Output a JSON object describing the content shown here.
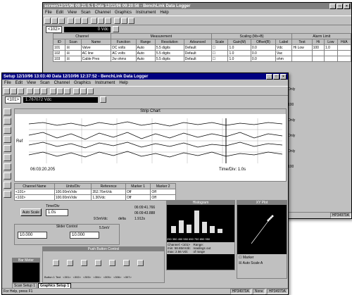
{
  "back_window": {
    "title": "screen12/11/96 09:21:5.1   Data 12/11/96 09:20:56 - BenchLink Data Logger",
    "menu": [
      "File",
      "Edit",
      "View",
      "Scan",
      "Channel",
      "Graphics",
      "Instrument",
      "Help"
    ],
    "channel_select": "<102>",
    "readout": "0 Vdc",
    "group_headers": {
      "channel": "Channel",
      "measurement": "Measurement",
      "scaling": "Scaling (Mx+B)",
      "alarm": "Alarm Limit"
    },
    "columns": [
      "ID",
      "Scan",
      "Name",
      "Function",
      "Range",
      "Resolution",
      "Advanced",
      "Scale",
      "Gain(M)",
      "Offset(B)",
      "Label",
      "Test",
      "Hi",
      "Low",
      "Hi/A"
    ],
    "rows": [
      {
        "id": "101",
        "name": "Valve",
        "function": "DC volts",
        "range": "Auto",
        "resolution": "5.5 digits",
        "advanced": "Default",
        "gain": "1.0",
        "offset": "0.0",
        "label": "Vdc",
        "test": "Hi Low",
        "hi": "100",
        "low": "1.0"
      },
      {
        "id": "102",
        "name": "AC line",
        "function": "AC volts",
        "range": "Auto",
        "resolution": "5.5 digits",
        "advanced": "Default",
        "gain": "1.0",
        "offset": "0.0",
        "label": "Vac",
        "test": "",
        "hi": "",
        "low": ""
      },
      {
        "id": "103",
        "name": "Cable Pres",
        "function": "2w ohms",
        "range": "Auto",
        "resolution": "5.5 digits",
        "advanced": "Default",
        "gain": "1.0",
        "offset": "0.0",
        "label": "ohm",
        "test": "",
        "hi": "",
        "low": ""
      }
    ],
    "right_col_values": [
      "Only",
      "100",
      "Only",
      "Only",
      "Only",
      "100"
    ],
    "status": "HP34970A"
  },
  "front_window": {
    "title": "Setup 12/10/96 13:03:40   Data 12/10/96 12:37:52 - BenchLink Data Logger",
    "menu": [
      "File",
      "Edit",
      "View",
      "Scan",
      "Channel",
      "Graphics",
      "Instrument",
      "Help"
    ],
    "channel_select": "<101>",
    "readout": "1.767072 Vdc",
    "strip_chart": {
      "title": "Strip Chart",
      "y_label": "Ref",
      "time_start": "06:03:20.205",
      "time_div": "Time/Div: 1.0s"
    },
    "grid": {
      "headers": [
        "Channel Name",
        "Units/Div",
        "Reference",
        "Marker 1",
        "Marker 2"
      ],
      "rows": [
        [
          "<101>",
          "100.00mV/div",
          "352.76mVdc",
          "Off",
          "Off"
        ],
        [
          "<102>",
          "100.00mV/div",
          "1.30Vdc",
          "Off",
          "Off"
        ]
      ]
    },
    "controls": {
      "autoscale_label": "Auto Scale",
      "time_div_label": "Time/Div",
      "time_div_value": "1.0s",
      "delta_label": "delta",
      "delta_value": "9.5mVdc",
      "m1_value": "06:09:41.766",
      "m2_value": "06:09:43.888",
      "t_delta_value": "1.912s"
    },
    "slider_control": {
      "title": "Slider Control",
      "value_left": "10.000",
      "value_right": "10.000",
      "unit": "5.5mV"
    },
    "histogram": {
      "title": "Histogram",
      "channel_label": "Channel:",
      "channel_value": "<101>",
      "min_label": "min:",
      "min_value": "58.65mVdc",
      "max_label": "max:",
      "max_value": "2.56 Vdc",
      "bin_labels": "250 350 450 550 650 750 850 950",
      "range_label": "Range: readings out of range"
    },
    "xy_plot": {
      "title": "XY Plot",
      "marker_label": "Marker",
      "autoscale_label": "Auto Scale A"
    },
    "push_button": {
      "title": "Push Button Control",
      "button_label": "Button 1 Text",
      "channels": [
        "<301>",
        "<302>",
        "<303>",
        "<304>",
        "<305>",
        "<306>",
        "<307>"
      ]
    },
    "bar_meter": "Bar Meter",
    "tabs": [
      "Scan Setup 1",
      "Graphics Setup 1"
    ],
    "status": {
      "help": "For Help, press F1",
      "instrument": "HP34970A",
      "none": "None",
      "model": "HP34970A"
    }
  }
}
